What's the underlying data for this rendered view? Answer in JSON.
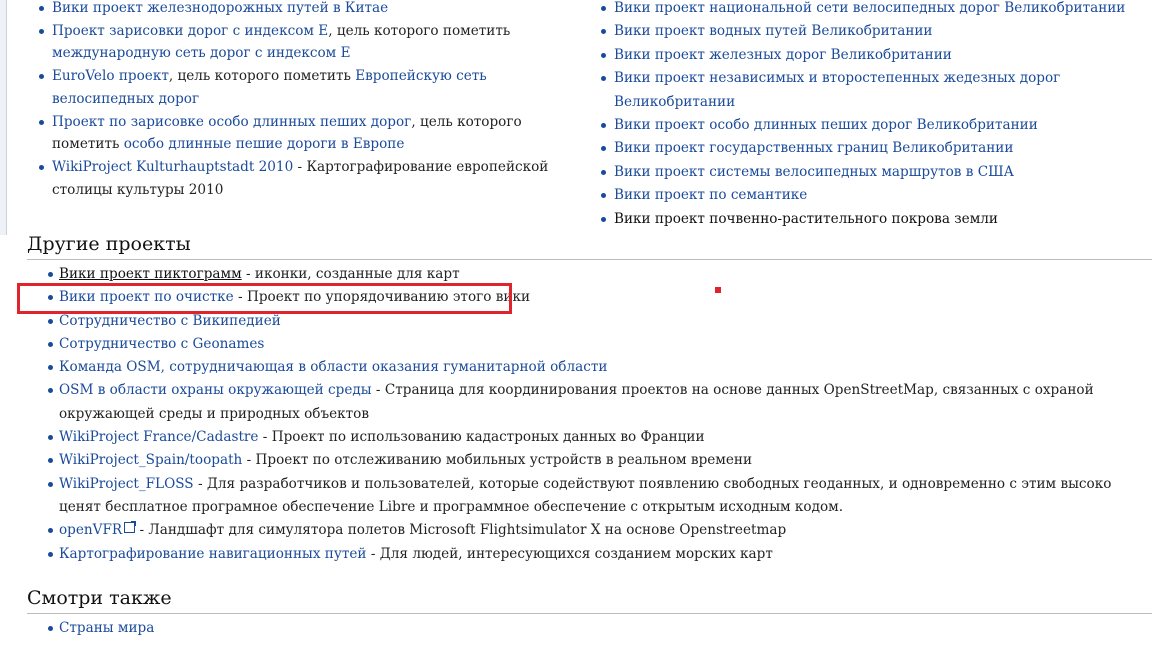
{
  "top_left": [
    {
      "link": "Вики проект железнодорожных путей в Китае"
    },
    {
      "link": "Проект зарисовки дорог с индексом E",
      "text": ", цель которого пометить ",
      "link2": "международную сеть дорог с индексом E"
    },
    {
      "link": "EuroVelo проект",
      "text": ", цель которого пометить ",
      "link2": "Европейскую сеть велосипедных дорог"
    },
    {
      "link": "Проект по зарисовке особо длинных пеших дорог",
      "text": ", цель которого пометить ",
      "link2": "особо длинные пешие дороги в Европе"
    },
    {
      "link": "WikiProject Kulturhauptstadt 2010",
      "text": " - Картографирование европейской столицы культуры 2010"
    }
  ],
  "top_right": [
    "Вики проект национальной сети велосипедных дорог Великобритании",
    "Вики проект водных путей Великобритании",
    "Вики проект железных дорог Великобритании",
    "Вики проект независимых и второстепенных жедезных дорог Великобритании",
    "Вики проект особо длинных пеших дорог Великобритании",
    "Вики проект государственных границ Великобритании",
    "Вики проект системы велосипедных маршрутов в США",
    "Вики проект по семантике"
  ],
  "top_right_plain": "Вики проект почвенно-растительного покрова земли",
  "other_projects": {
    "heading": "Другие проекты",
    "items": [
      {
        "link": "Вики проект пиктограмм",
        "text": " - иконки, созданные для карт"
      },
      {
        "link": "Вики проект по очистке",
        "text": " - Проект по упорядочиванию этого вики"
      },
      {
        "link": "Сотрудничество с Википедией",
        "text": ""
      },
      {
        "link": "Сотрудничество с Geonames",
        "text": ""
      },
      {
        "link": "Команда OSM, сотрудничающая в области оказания гуманитарной области",
        "text": ""
      },
      {
        "link": "OSM в области охраны окружающей среды",
        "text": " - Страница для координирования проектов на основе данных OpenStreetMap, связанных с охраной окружающей среды и природных объектов"
      },
      {
        "link": "WikiProject France/Cadastre",
        "text": " - Проект по использованию кадастроных данных во Франции"
      },
      {
        "link": "WikiProject_Spain/toopath",
        "text": " - Проект по отслеживанию мобильных устройств в реальном времени"
      },
      {
        "link": "WikiProject_FLOSS",
        "text": " - Для разработчиков и пользователей, которые содействуют появлению свободных геоданных, и одновременно с этим высоко ценят бесплатное програмное обеспечение Libre и программное обеспечение с открытым исходным кодом."
      },
      {
        "link": "openVFR",
        "text": " - Ландшафт для симулятора полетов Microsoft Flightsimulator X на основе Openstreetmap"
      },
      {
        "link": "Картографирование навигационных путей",
        "text": " - Для людей, интересующихся созданием морских карт"
      }
    ]
  },
  "see_also": {
    "heading": "Смотри также",
    "items": [
      "Страны мира"
    ]
  },
  "colors": {
    "link": "#1a4a9a",
    "highlight": "#e0242c"
  },
  "icons": {
    "external_link": "external-link-icon"
  }
}
